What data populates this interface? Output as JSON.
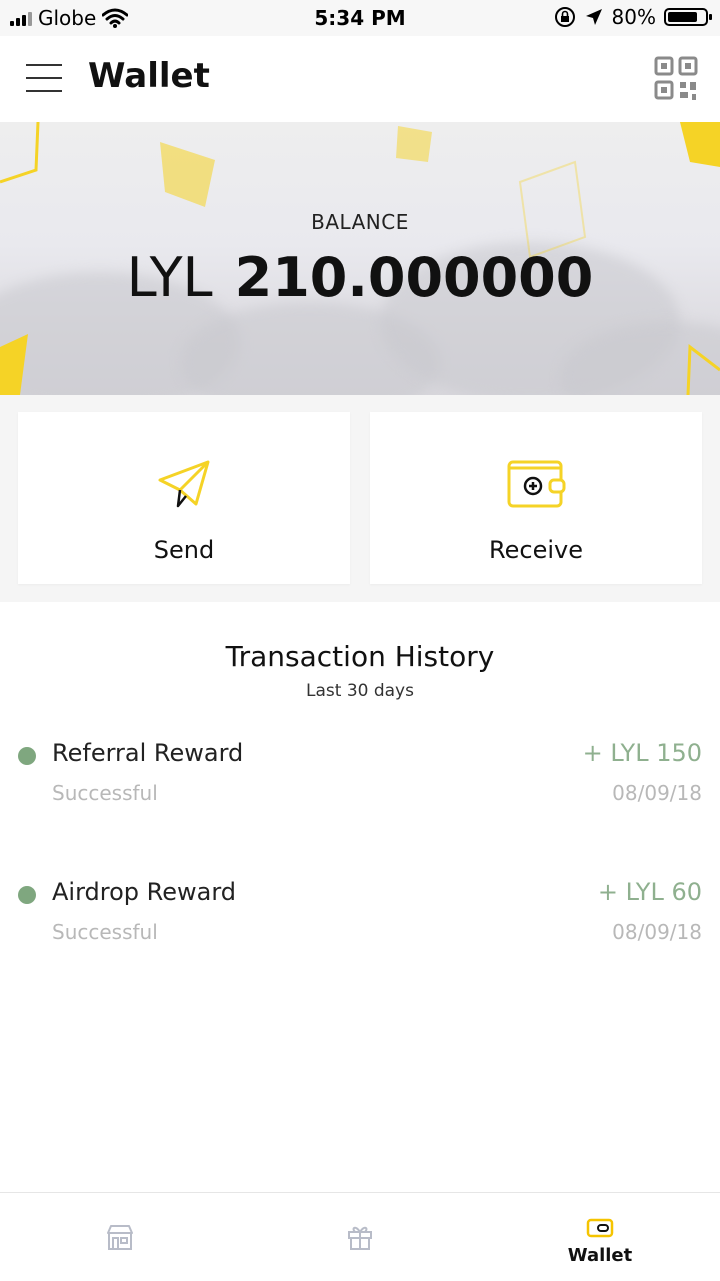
{
  "status_bar": {
    "carrier": "Globe",
    "time": "5:34 PM",
    "battery": "80%",
    "battery_level": 0.8
  },
  "header": {
    "title": "Wallet",
    "menu_icon": "hamburger-menu-icon",
    "qr_icon": "qr-code-icon"
  },
  "balance": {
    "label": "BALANCE",
    "currency": "LYL",
    "amount": "210.000000"
  },
  "actions": {
    "send_label": "Send",
    "receive_label": "Receive",
    "accent_color": "#f5d326"
  },
  "history": {
    "title": "Transaction History",
    "subtitle": "Last 30 days",
    "items": [
      {
        "title": "Referral Reward",
        "status": "Successful",
        "amount": "+ LYL 150",
        "date": "08/09/18"
      },
      {
        "title": "Airdrop Reward",
        "status": "Successful",
        "amount": "+ LYL 60",
        "date": "08/09/18"
      }
    ],
    "success_color": "#7fa77f"
  },
  "bottom_nav": {
    "items": [
      {
        "label": "",
        "icon": "store-icon"
      },
      {
        "label": "",
        "icon": "gift-icon"
      },
      {
        "label": "Wallet",
        "icon": "wallet-icon",
        "active": true
      }
    ]
  }
}
